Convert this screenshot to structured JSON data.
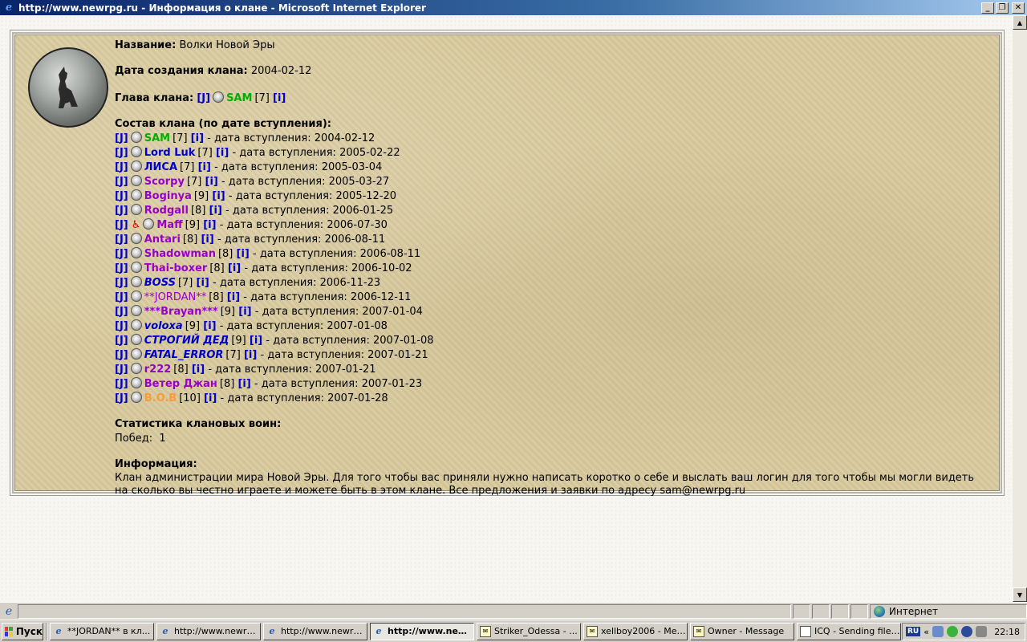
{
  "window": {
    "title": "http://www.newrpg.ru - Информация о клане - Microsoft Internet Explorer"
  },
  "clan": {
    "name_label": "Название:",
    "name": "Волки Новой Эры",
    "created_label": "Дата создания клана:",
    "created": "2004-02-12",
    "head_label": "Глава клана:",
    "head": {
      "tag": "[J]",
      "nick": "SAM",
      "level": "[7]",
      "info": "[i]"
    },
    "members_label": "Состав клана (по дате вступления):",
    "join_text": "- дата вступления:",
    "members": [
      {
        "tag": "[J]",
        "nick": "SAM",
        "level": "[7]",
        "info": "[i]",
        "date": "2004-02-12"
      },
      {
        "tag": "[J]",
        "nick": "Lord Luk",
        "level": "[7]",
        "info": "[i]",
        "date": "2005-02-22"
      },
      {
        "tag": "[J]",
        "nick": "ЛИСА",
        "level": "[7]",
        "info": "[i]",
        "date": "2005-03-04"
      },
      {
        "tag": "[J]",
        "nick": "Scorpy",
        "level": "[7]",
        "info": "[i]",
        "date": "2005-03-27"
      },
      {
        "tag": "[J]",
        "nick": "Boginya",
        "level": "[9]",
        "info": "[i]",
        "date": "2005-12-20"
      },
      {
        "tag": "[J]",
        "nick": "Rodgall",
        "level": "[8]",
        "info": "[i]",
        "date": "2006-01-25"
      },
      {
        "tag": "[J]",
        "nick": "Maff",
        "level": "[9]",
        "info": "[i]",
        "date": "2006-07-30"
      },
      {
        "tag": "[J]",
        "nick": "Antari",
        "level": "[8]",
        "info": "[i]",
        "date": "2006-08-11"
      },
      {
        "tag": "[J]",
        "nick": "Shadowman",
        "level": "[8]",
        "info": "[i]",
        "date": "2006-08-11"
      },
      {
        "tag": "[J]",
        "nick": "Thai-boxer",
        "level": "[8]",
        "info": "[i]",
        "date": "2006-10-02"
      },
      {
        "tag": "[J]",
        "nick": "BOSS",
        "level": "[7]",
        "info": "[i]",
        "date": "2006-11-23"
      },
      {
        "tag": "[J]",
        "nick": "**JORDAN**",
        "level": "[8]",
        "info": "[i]",
        "date": "2006-12-11"
      },
      {
        "tag": "[J]",
        "nick": "***Brayan***",
        "level": "[9]",
        "info": "[i]",
        "date": "2007-01-04"
      },
      {
        "tag": "[J]",
        "nick": "voloxa",
        "level": "[9]",
        "info": "[i]",
        "date": "2007-01-08"
      },
      {
        "tag": "[J]",
        "nick": "СТРОГИЙ ДЕД",
        "level": "[9]",
        "info": "[i]",
        "date": "2007-01-08"
      },
      {
        "tag": "[J]",
        "nick": "FATAL_ERROR",
        "level": "[7]",
        "info": "[i]",
        "date": "2007-01-21"
      },
      {
        "tag": "[J]",
        "nick": "r222",
        "level": "[8]",
        "info": "[i]",
        "date": "2007-01-21"
      },
      {
        "tag": "[J]",
        "nick": "Ветер Джан",
        "level": "[8]",
        "info": "[i]",
        "date": "2007-01-23"
      },
      {
        "tag": "[J]",
        "nick": "B.O.B",
        "level": "[10]",
        "info": "[i]",
        "date": "2007-01-28"
      }
    ],
    "stats_label": "Статистика клановых воин:",
    "wins": "Побед:  1",
    "info_label": "Информация:",
    "info": "Клан администрации мира Новой Эры. Для того чтобы вас приняли нужно написать коротко о себе и выслать ваш логин для того чтобы мы могли видеть на сколько вы честно играете и можете быть в этом клане. Все предложения и заявки по адресу sam@newrpg.ru"
  },
  "statusbar": {
    "zone": "Интернет"
  },
  "taskbar": {
    "start": "Пуск",
    "tasks": [
      "**JORDAN** в кл...",
      "http://www.newrp...",
      "http://www.newrp...",
      "http://www.new...",
      "Striker_Odessa - ...",
      "xellboy2006 - Mes...",
      "Owner - Message",
      "ICQ - Sending files..."
    ],
    "lang": "RU",
    "clock": "22:18"
  },
  "colors": {
    "green": "#00b000",
    "blue": "#0000cc",
    "purple": "#9900cc",
    "orange": "#ff9933"
  }
}
